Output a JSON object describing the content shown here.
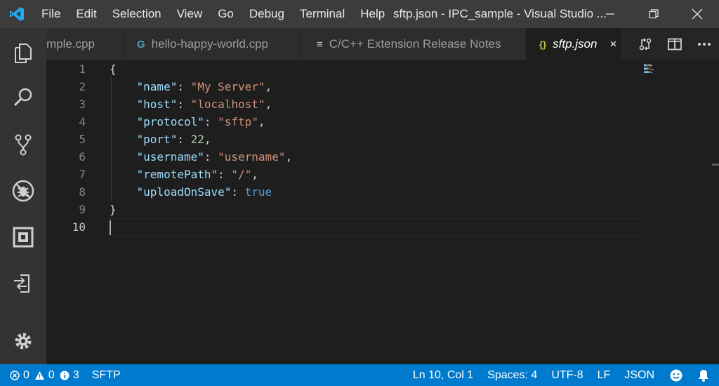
{
  "colors": {
    "accent": "#007acc",
    "titlebar": "#3c3c3c",
    "activitybar": "#333333",
    "editor_bg": "#1e1e1e",
    "string": "#ce9178",
    "key": "#9cdcfe",
    "number": "#b5cea8",
    "boolean": "#569cd6"
  },
  "titlebar": {
    "menu": [
      "File",
      "Edit",
      "Selection",
      "View",
      "Go",
      "Debug",
      "Terminal",
      "Help"
    ],
    "title": "sftp.json - IPC_sample - Visual Studio ..."
  },
  "activity_icons": [
    "explorer-icon",
    "search-icon",
    "source-control-icon",
    "debug-icon",
    "extensions-icon",
    "remote-sftp-icon",
    "settings-gear-icon"
  ],
  "tabs": [
    {
      "label": "mple.cpp",
      "icon": ""
    },
    {
      "label": "hello-happy-world.cpp",
      "icon": "G"
    },
    {
      "label": "C/C++ Extension Release Notes",
      "icon": "≡"
    },
    {
      "label": "sftp.json",
      "icon": "{}",
      "active": true,
      "close": "×"
    }
  ],
  "editor": {
    "line_numbers": [
      "1",
      "2",
      "3",
      "4",
      "5",
      "6",
      "7",
      "8",
      "9",
      "10"
    ],
    "lines": [
      {
        "p": "{"
      },
      {
        "indent": "    ",
        "key": "\"name\"",
        "colon": ": ",
        "val": "\"My Server\"",
        "vtype": "s",
        "end": ","
      },
      {
        "indent": "    ",
        "key": "\"host\"",
        "colon": ": ",
        "val": "\"localhost\"",
        "vtype": "s",
        "end": ","
      },
      {
        "indent": "    ",
        "key": "\"protocol\"",
        "colon": ": ",
        "val": "\"sftp\"",
        "vtype": "s",
        "end": ","
      },
      {
        "indent": "    ",
        "key": "\"port\"",
        "colon": ": ",
        "val": "22",
        "vtype": "n",
        "end": ","
      },
      {
        "indent": "    ",
        "key": "\"username\"",
        "colon": ": ",
        "val": "\"username\"",
        "vtype": "s",
        "end": ","
      },
      {
        "indent": "    ",
        "key": "\"remotePath\"",
        "colon": ": ",
        "val": "\"/\"",
        "vtype": "s",
        "end": ","
      },
      {
        "indent": "    ",
        "key": "\"uploadOnSave\"",
        "colon": ": ",
        "val": "true",
        "vtype": "b",
        "end": ""
      },
      {
        "p": "}"
      },
      {
        "p": ""
      }
    ]
  },
  "statusbar": {
    "errors": "0",
    "warnings": "0",
    "info": "3",
    "sftp": "SFTP",
    "position": "Ln 10, Col 1",
    "spaces": "Spaces: 4",
    "encoding": "UTF-8",
    "eol": "LF",
    "language": "JSON"
  }
}
